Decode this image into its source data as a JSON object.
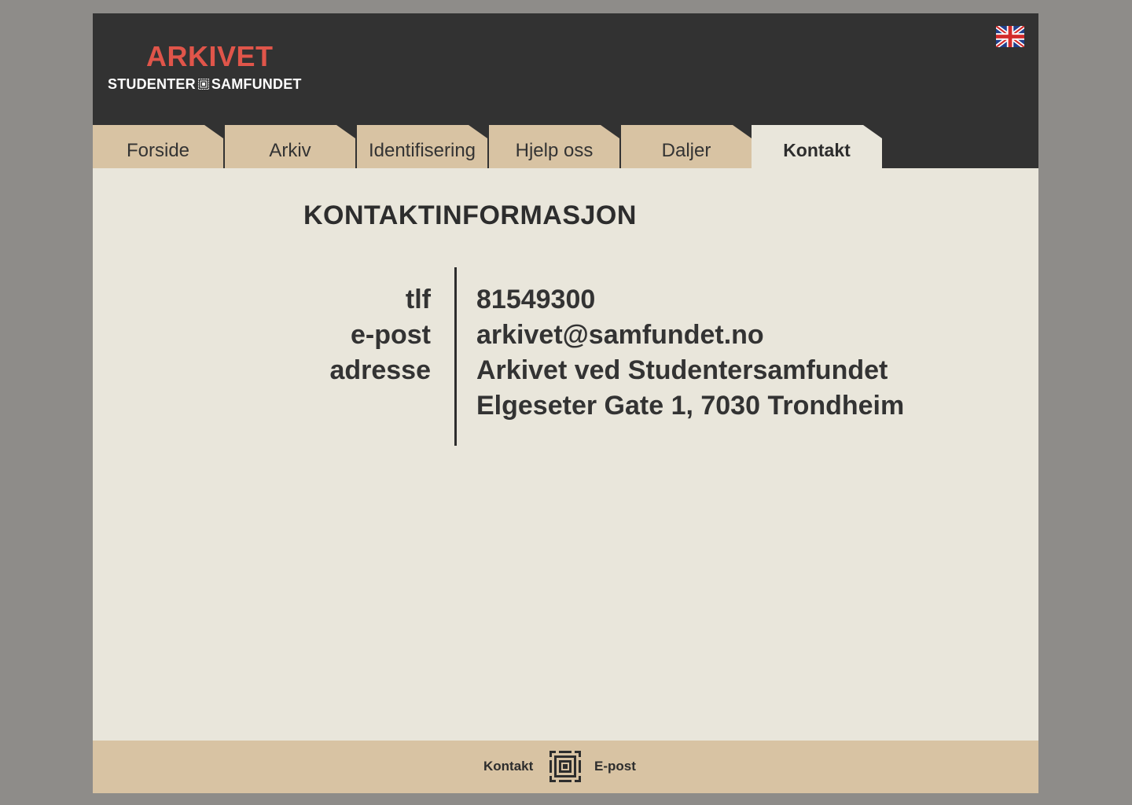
{
  "header": {
    "logo_title": "ARKIVET",
    "logo_sub_left": "STUDENTER",
    "logo_sub_right": "SAMFUNDET",
    "language_icon": "uk-flag-icon"
  },
  "tabs": [
    {
      "label": "Forside",
      "active": false
    },
    {
      "label": "Arkiv",
      "active": false
    },
    {
      "label": "Identifisering",
      "active": false
    },
    {
      "label": "Hjelp oss",
      "active": false
    },
    {
      "label": "Daljer",
      "active": false
    },
    {
      "label": "Kontakt",
      "active": true
    }
  ],
  "main": {
    "heading": "KONTAKTINFORMASJON",
    "contact": {
      "phone_label": "tlf",
      "phone_value": "81549300",
      "email_label": "e-post",
      "email_value": "arkivet@samfundet.no",
      "address_label": "adresse",
      "address_line1": "Arkivet ved Studentersamfundet",
      "address_line2": "Elgeseter Gate 1, 7030 Trondheim"
    }
  },
  "footer": {
    "contact_link": "Kontakt",
    "email_link": "E-post",
    "logo_icon": "samfundet-emblem-icon"
  },
  "colors": {
    "page_bg": "#8e8c89",
    "header_bg": "#323232",
    "content_bg": "#e9e6db",
    "tab_bg": "#d8c3a3",
    "logo_red": "#e0554a",
    "text": "#333333"
  }
}
